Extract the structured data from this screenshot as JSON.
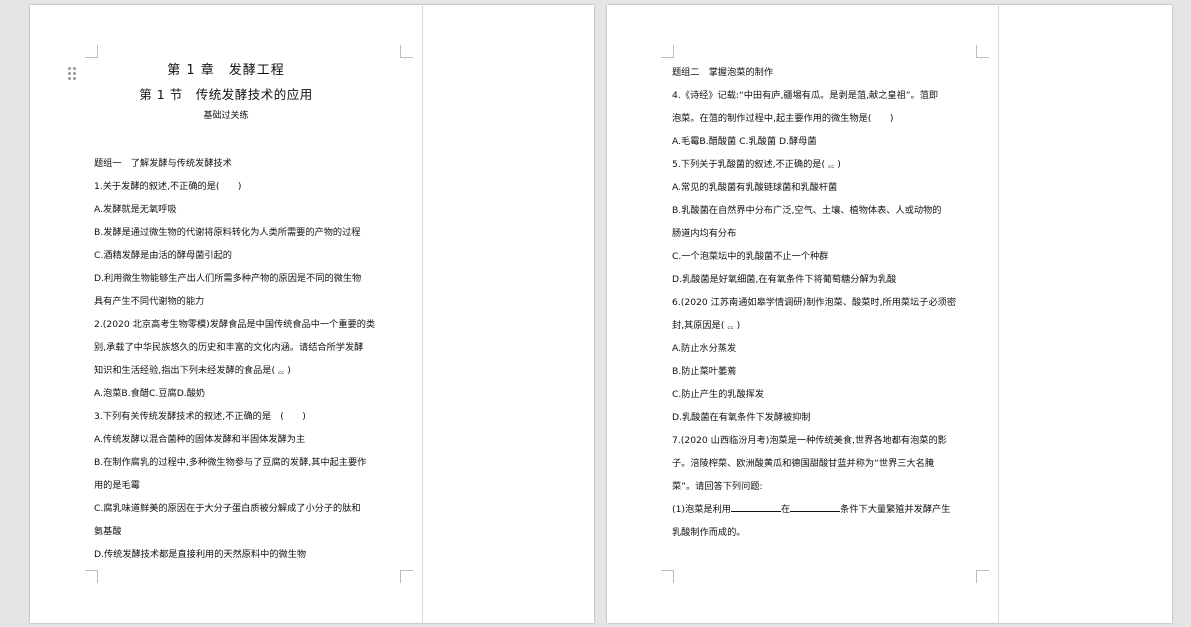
{
  "page1": {
    "chapter_title": "第 1 章　发酵工程",
    "section_title": "第 1 节　传统发酵技术的应用",
    "sub_title": "基础过关练",
    "lines": [
      "题组一　了解发酵与传统发酵技术",
      "1.关于发酵的叙述,不正确的是(　　)",
      "A.发酵就是无氧呼吸",
      "B.发酵是通过微生物的代谢将原料转化为人类所需要的产物的过程",
      "C.酒精发酵是由活的酵母菌引起的",
      "D.利用微生物能够生产出人们所需多种产物的原因是不同的微生物",
      "具有产生不同代谢物的能力",
      "2.(2020 北京高考生物零模)发酵食品是中国传统食品中一个重要的类",
      "别,承载了中华民族悠久的历史和丰富的文化内涵。请结合所学发酵",
      "知识和生活经验,指出下列未经发酵的食品是(  ꜀꜀  )",
      "A.泡菜B.食醋C.豆腐D.酸奶",
      "3.下列有关传统发酵技术的叙述,不正确的是　(　　)",
      "A.传统发酵以混合菌种的固体发酵和半固体发酵为主",
      "B.在制作腐乳的过程中,多种微生物参与了豆腐的发酵,其中起主要作",
      "用的是毛霉",
      "C.腐乳味道鲜美的原因在于大分子蛋白质被分解成了小分子的肽和",
      "氨基酸",
      "D.传统发酵技术都是直接利用的天然原料中的微生物"
    ]
  },
  "page2": {
    "lines": [
      "题组二　掌握泡菜的制作",
      "4.《诗经》记载:“中田有庐,疆埸有瓜。是剥是菹,献之皇祖”。菹即",
      "泡菜。在菹的制作过程中,起主要作用的微生物是(　　)",
      "A.毛霉B.醋酸菌  C.乳酸菌  D.酵母菌",
      "5.下列关于乳酸菌的叙述,不正确的是(  ꜀꜀  )",
      "A.常见的乳酸菌有乳酸链球菌和乳酸杆菌",
      "B.乳酸菌在自然界中分布广泛,空气、土壤、植物体表、人或动物的",
      "肠道内均有分布",
      "C.一个泡菜坛中的乳酸菌不止一个种群",
      "D.乳酸菌是好氧细菌,在有氧条件下将葡萄糖分解为乳酸",
      "6.(2020 江苏南通如皋学情调研)制作泡菜、酸菜时,所用菜坛子必须密",
      "封,其原因是(  ꜀꜀  )",
      "A.防止水分蒸发",
      "B.防止菜叶萎蔫",
      "C.防止产生的乳酸挥发",
      "D.乳酸菌在有氧条件下发酵被抑制",
      "7.(2020 山西临汾月考)泡菜是一种传统美食,世界各地都有泡菜的影",
      "子。涪陵榨菜、欧洲酸黄瓜和德国甜酸甘蓝并称为“世界三大名腌",
      "菜”。请回答下列问题:"
    ],
    "q7_part1": {
      "prefix": "(1)泡菜是利用",
      "middle": "在",
      "suffix": "条件下大量繁殖并发酵产生"
    },
    "q7_part2": "乳酸制作而成的。"
  }
}
